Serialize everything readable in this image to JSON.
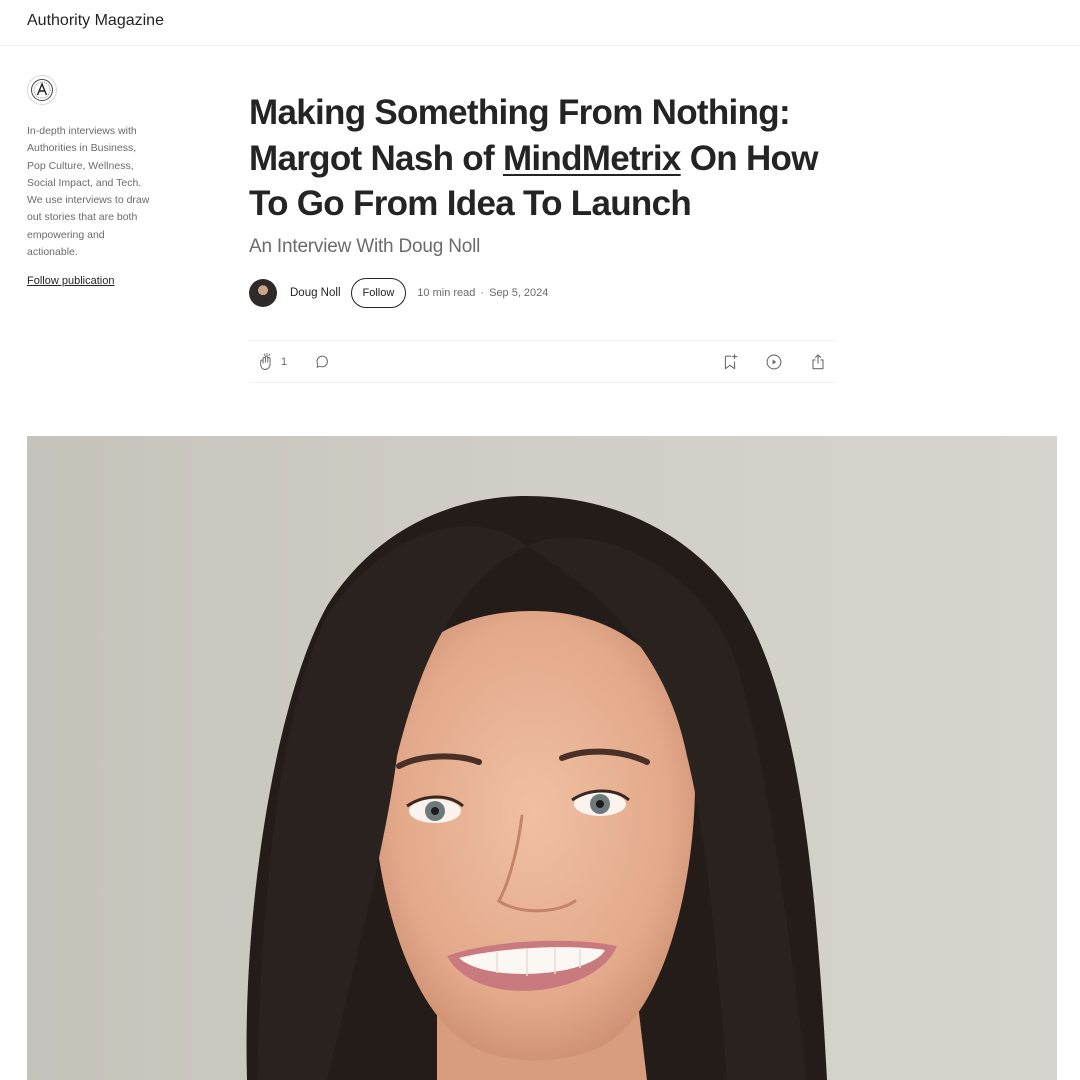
{
  "header": {
    "brand": "Authority Magazine"
  },
  "sidebar": {
    "logo_icon": "authority-magazine-logo",
    "description": "In-depth interviews with Authorities in Business, Pop Culture, Wellness, Social Impact, and Tech. We use interviews to draw out stories that are both empowering and actionable.",
    "follow_label": "Follow publication"
  },
  "article": {
    "title_part1": "Making Something From Nothing: Margot Nash of ",
    "title_link": "MindMetrix",
    "title_part2": " On How To Go From Idea To Launch",
    "subtitle": "An Interview With Doug Noll",
    "author": "Doug Noll",
    "follow_label": "Follow",
    "read_time": "10 min read",
    "date": "Sep 5, 2024",
    "separator": "·"
  },
  "actions": {
    "clap_count": "1",
    "icons": [
      "clap-icon",
      "comment-icon",
      "bookmark-add-icon",
      "listen-play-icon",
      "share-icon"
    ]
  },
  "hero": {
    "icon": "portrait-photo"
  }
}
